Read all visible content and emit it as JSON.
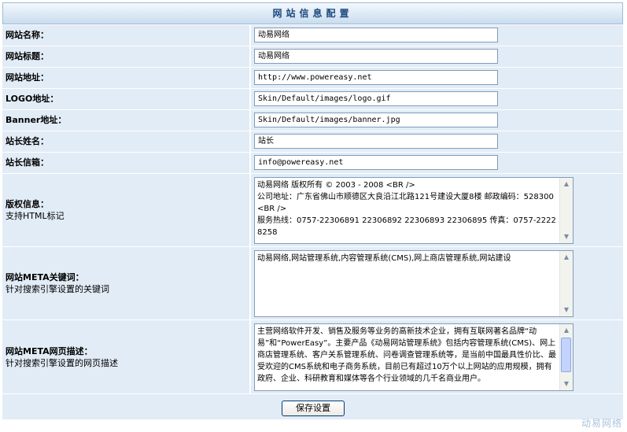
{
  "header": {
    "title": "网站信息配置"
  },
  "fields": [
    {
      "label": "网站名称：",
      "value": "动易网络"
    },
    {
      "label": "网站标题：",
      "value": "动易网络"
    },
    {
      "label": "网站地址：",
      "value": "http://www.powereasy.net"
    },
    {
      "label": "LOGO地址：",
      "value": "Skin/Default/images/logo.gif"
    },
    {
      "label": "Banner地址：",
      "value": "Skin/Default/images/banner.jpg"
    },
    {
      "label": "站长姓名：",
      "value": "站长"
    },
    {
      "label": "站长信箱：",
      "value": "info@powereasy.net"
    }
  ],
  "copyright": {
    "label": "版权信息：",
    "hint": "支持HTML标记",
    "value": "动易网络 版权所有 © 2003 - 2008 <BR />\n公司地址：广东省佛山市顺德区大良沿江北路121号建设大厦8楼 邮政编码：528300 <BR />\n服务热线：0757-22306891 22306892 22306893 22306895 传真：0757-22228258"
  },
  "meta_keywords": {
    "label": "网站META关键词：",
    "hint": "针对搜索引擎设置的关键词",
    "value": "动易网络,网站管理系统,内容管理系统(CMS),网上商店管理系统,网站建设"
  },
  "meta_description": {
    "label": "网站META网页描述：",
    "hint": "针对搜索引擎设置的网页描述",
    "value": "主营网络软件开发、销售及服务等业务的高新技术企业，拥有互联网著名品牌“动易”和“PowerEasy”。主要产品《动易网站管理系统》包括内容管理系统(CMS)、网上商店管理系统、客户关系管理系统、问卷调查管理系统等，是当前中国最具性价比、最受欢迎的CMS系统和电子商务系统，目前已有超过10万个以上网站的应用规模，拥有政府、企业、科研教育和媒体等各个行业领域的几千名商业用户。"
  },
  "save_button": "保存设置",
  "watermark": "动易网络"
}
